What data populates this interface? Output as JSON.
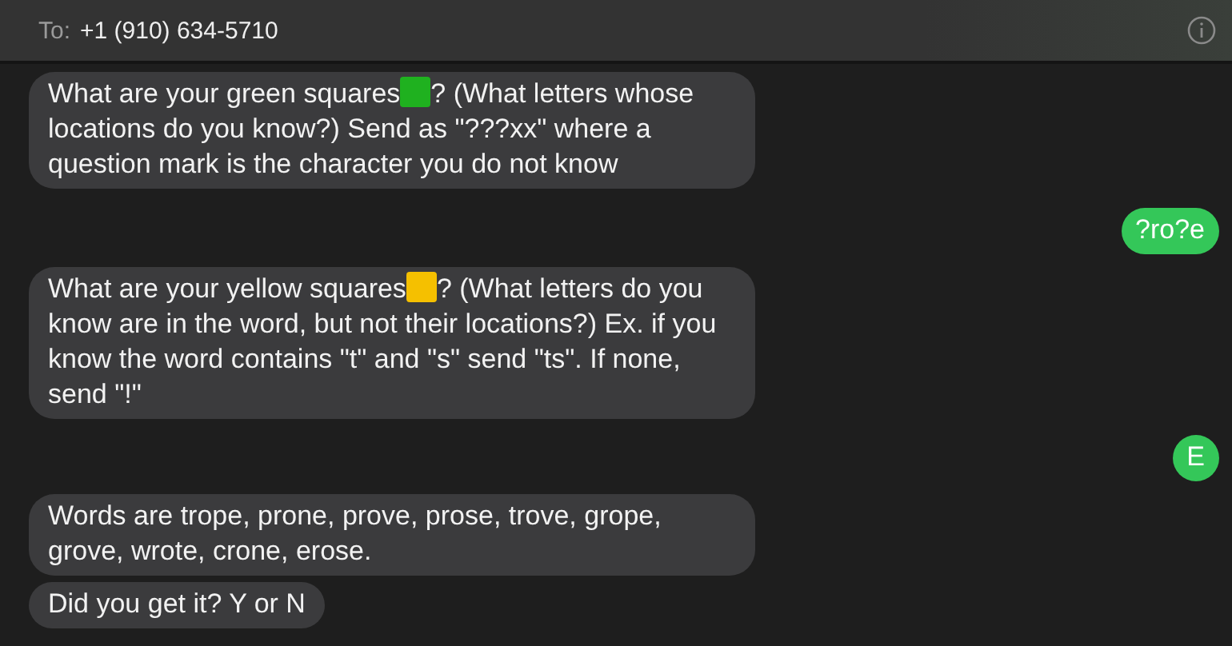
{
  "header": {
    "to_label": "To:",
    "recipient": "+1 (910) 634-5710"
  },
  "messages": [
    {
      "kind": "received",
      "parts": [
        {
          "kind": "text",
          "text": "What are your green squares"
        },
        {
          "kind": "square",
          "color": "#1fb11f"
        },
        {
          "kind": "text",
          "text": "? (What letters whose locations do you know?) Send as \"???xx\" where a question mark is the character you do not know"
        }
      ]
    },
    {
      "kind": "sent",
      "parts": [
        {
          "kind": "text",
          "text": "?ro?e"
        }
      ]
    },
    {
      "kind": "received",
      "parts": [
        {
          "kind": "text",
          "text": "What are your yellow squares"
        },
        {
          "kind": "square",
          "color": "#f5c000"
        },
        {
          "kind": "text",
          "text": "? (What letters do you know are in the word, but not their locations?) Ex. if you know the word contains \"t\" and \"s\" send \"ts\". If none, send \"!\""
        }
      ]
    },
    {
      "kind": "sent",
      "parts": [
        {
          "kind": "text",
          "text": "E"
        }
      ]
    },
    {
      "kind": "received",
      "parts": [
        {
          "kind": "text",
          "text": "Words are trope, prone, prove, prose, trove, grope, grove, wrote, crone, erose."
        }
      ]
    },
    {
      "kind": "received",
      "parts": [
        {
          "kind": "text",
          "text": "Did you get it? Y or N"
        }
      ]
    }
  ]
}
